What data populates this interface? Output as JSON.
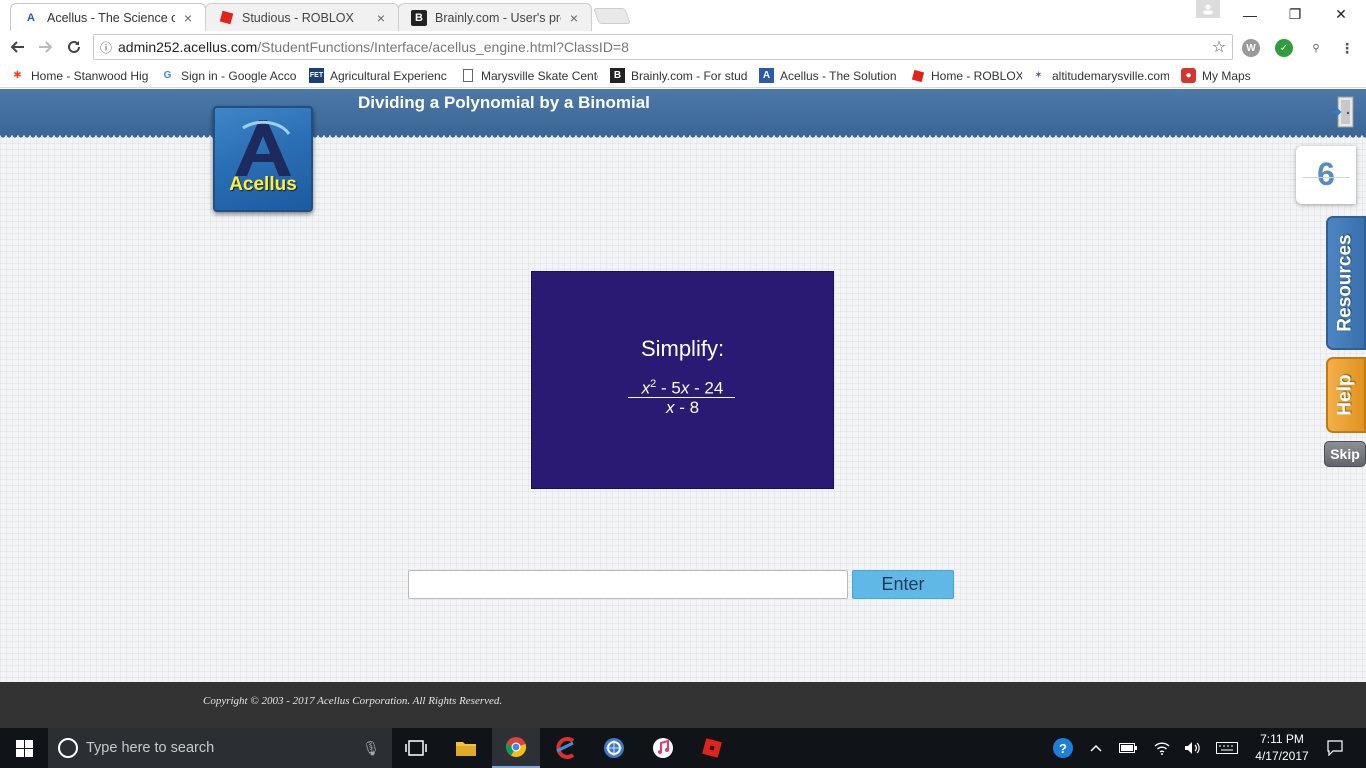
{
  "browser": {
    "tabs": [
      {
        "title": "Acellus - The Science of L",
        "close": "×"
      },
      {
        "title": "Studious - ROBLOX",
        "close": "×"
      },
      {
        "title": "Brainly.com - User's prof",
        "close": "×"
      }
    ],
    "window_controls": {
      "minimize": "—",
      "restore": "❐",
      "close": "✕"
    },
    "url_host": "admin252.acellus.com",
    "url_path": "/StudentFunctions/Interface/acellus_engine.html?ClassID=8",
    "info_icon": "ⓘ",
    "star_icon": "☆",
    "bookmarks": [
      {
        "label": "Home - Stanwood Hig",
        "icon": "joomla-icon"
      },
      {
        "label": "Sign in - Google Acco",
        "icon": "google-icon"
      },
      {
        "label": "Agricultural Experienc",
        "icon": "fet-icon"
      },
      {
        "label": "Marysville Skate Cente",
        "icon": "page-icon"
      },
      {
        "label": "Brainly.com - For stud",
        "icon": "brainly-icon"
      },
      {
        "label": "Acellus - The Solution",
        "icon": "acellus-icon"
      },
      {
        "label": "Home - ROBLOX",
        "icon": "roblox-icon"
      },
      {
        "label": "altitudemarysville.com",
        "icon": "altitude-icon"
      },
      {
        "label": "My Maps",
        "icon": "maps-icon"
      }
    ]
  },
  "lesson": {
    "title": "Dividing a Polynomial by a Binomial",
    "logo_text": "Acellus",
    "step_number": "6",
    "resources_label": "Resources",
    "help_label": "Help",
    "skip_label": "Skip",
    "problem": {
      "prompt": "Simplify:",
      "numerator_var": "x",
      "numerator_exp": "2",
      "numerator_rest_1": " - 5",
      "numerator_var_2": "x",
      "numerator_rest_2": " - 24",
      "denominator_var": "x",
      "denominator_rest": " - 8"
    },
    "answer_value": "",
    "enter_label": "Enter",
    "copyright": "Copyright © 2003 - 2017 Acellus Corporation.  All Rights Reserved."
  },
  "taskbar": {
    "search_placeholder": "Type here to search",
    "apps": [
      "task-view-icon",
      "file-explorer-icon",
      "chrome-icon",
      "ccleaner-icon",
      "browser-globe-icon",
      "itunes-icon",
      "roblox-icon"
    ],
    "time": "7:11 PM",
    "date": "4/17/2017"
  },
  "colors": {
    "banner": "#3b6695",
    "problem_bg": "#2a1a73",
    "enter_button": "#5fb8e6",
    "help_button": "#e0921f",
    "resources_button": "#3970ad"
  }
}
